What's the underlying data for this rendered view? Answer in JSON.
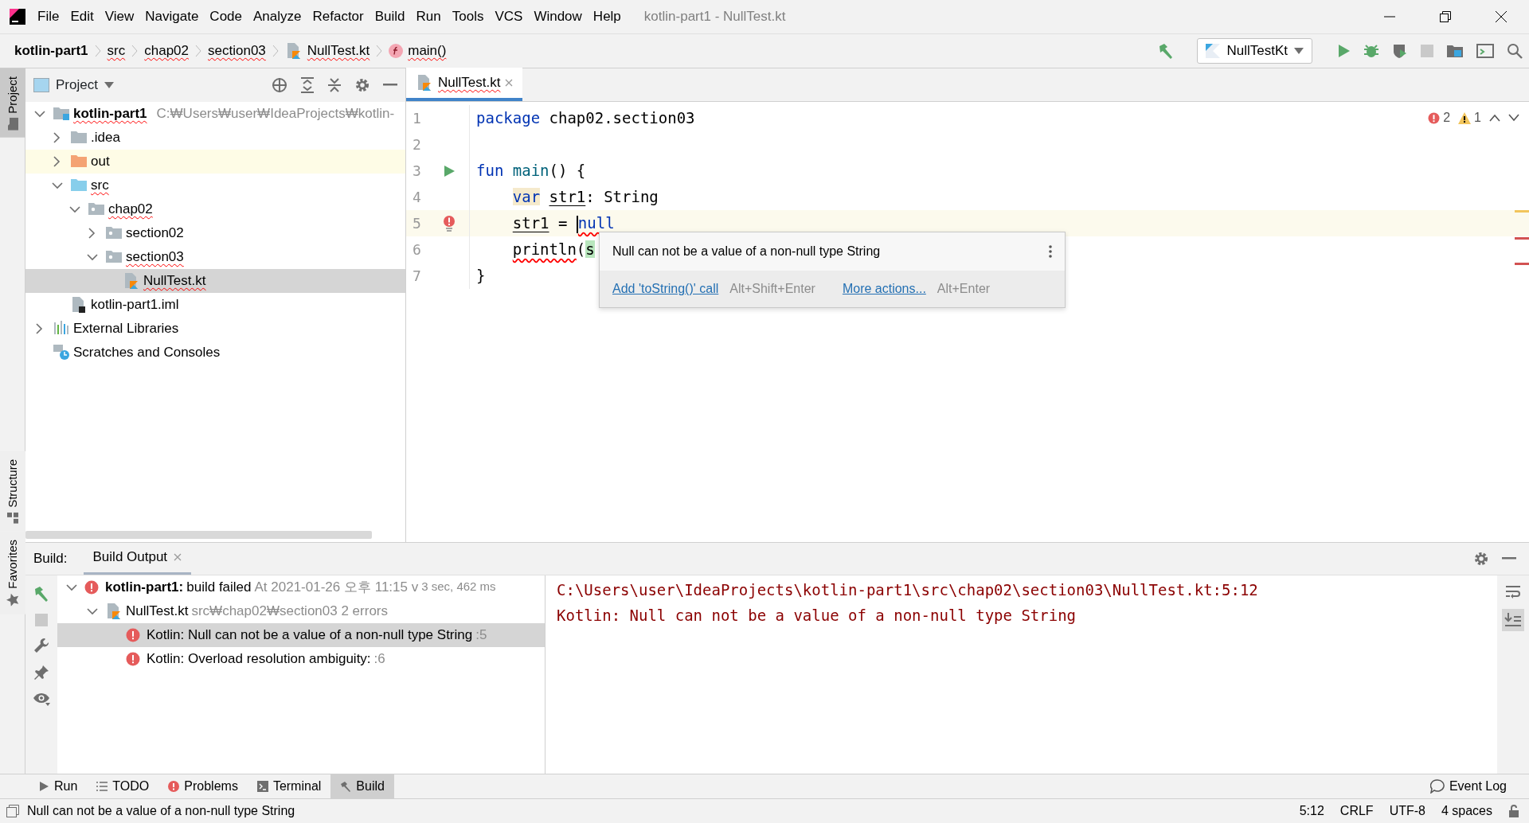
{
  "window": {
    "title": "kotlin-part1 - NullTest.kt"
  },
  "menu": [
    "File",
    "Edit",
    "View",
    "Navigate",
    "Code",
    "Analyze",
    "Refactor",
    "Build",
    "Run",
    "Tools",
    "VCS",
    "Window",
    "Help"
  ],
  "breadcrumbs": [
    {
      "label": "kotlin-part1",
      "kind": "project",
      "error": false
    },
    {
      "label": "src",
      "kind": "folder",
      "error": true
    },
    {
      "label": "chap02",
      "kind": "folder",
      "error": true
    },
    {
      "label": "section03",
      "kind": "folder",
      "error": true
    },
    {
      "label": "NullTest.kt",
      "kind": "file",
      "error": true
    },
    {
      "label": "main()",
      "kind": "function",
      "error": true
    }
  ],
  "run_config": {
    "label": "NullTestKt"
  },
  "left_stripe": [
    {
      "label": "Project",
      "selected": true,
      "kind": "top"
    },
    {
      "label": "Structure",
      "selected": false,
      "kind": "bottom"
    },
    {
      "label": "Favorites",
      "selected": false,
      "kind": "bottom"
    }
  ],
  "project_panel": {
    "title": "Project",
    "tree": [
      {
        "label": "kotlin-part1",
        "kind": "module",
        "path": "C:₩Users₩user₩IdeaProjects₩kotlin-",
        "error": true,
        "expanded": true,
        "selected": false,
        "highlighted": false,
        "children": [
          {
            "label": ".idea",
            "kind": "folder",
            "error": false,
            "expanded": false,
            "selected": false,
            "highlighted": false
          },
          {
            "label": "out",
            "kind": "excluded",
            "error": false,
            "expanded": false,
            "selected": false,
            "highlighted": true
          },
          {
            "label": "src",
            "kind": "source",
            "error": true,
            "expanded": true,
            "selected": false,
            "highlighted": false,
            "children": [
              {
                "label": "chap02",
                "kind": "package",
                "error": true,
                "expanded": true,
                "selected": false,
                "highlighted": false,
                "children": [
                  {
                    "label": "section02",
                    "kind": "package",
                    "error": false,
                    "expanded": false,
                    "selected": false,
                    "highlighted": false
                  },
                  {
                    "label": "section03",
                    "kind": "package",
                    "error": true,
                    "expanded": true,
                    "selected": false,
                    "highlighted": false,
                    "children": [
                      {
                        "label": "NullTest.kt",
                        "kind": "kotlin",
                        "error": true,
                        "selected": true,
                        "highlighted": false
                      }
                    ]
                  }
                ]
              }
            ]
          },
          {
            "label": "kotlin-part1.iml",
            "kind": "iml",
            "error": false,
            "selected": false,
            "highlighted": false
          }
        ]
      },
      {
        "label": "External Libraries",
        "kind": "library",
        "error": false,
        "expanded": false,
        "selected": false,
        "highlighted": false
      },
      {
        "label": "Scratches and Consoles",
        "kind": "scratch",
        "error": false,
        "selected": false,
        "highlighted": false
      }
    ]
  },
  "editor": {
    "tabs": [
      {
        "label": "NullTest.kt",
        "selected": true,
        "error": true
      }
    ],
    "error_count": "2",
    "warning_count": "1",
    "lines": [
      {
        "number": "1",
        "current": false,
        "indented": false,
        "tokens": [
          {
            "text": "package",
            "kind": "keyword"
          },
          {
            "text": "chap02.section03",
            "kind": "text",
            "space_before": true
          }
        ]
      },
      {
        "number": "2",
        "current": false
      },
      {
        "number": "3",
        "kind": "run",
        "current": false,
        "indented": false,
        "tokens": [
          {
            "text": "fun",
            "kind": "keyword"
          },
          {
            "text": "main",
            "kind": "function",
            "space_before": true
          },
          {
            "text": "() {",
            "kind": "text"
          }
        ]
      },
      {
        "number": "4",
        "current": false,
        "indented": true,
        "tokens": [
          {
            "text": "var",
            "kind": "var-keyword"
          },
          {
            "text": "str1",
            "kind": "variable",
            "space_before": true
          },
          {
            "text": ": String",
            "kind": "text"
          }
        ]
      },
      {
        "number": "5",
        "kind": "error",
        "current": true,
        "indented": true,
        "tokens": [
          {
            "text": "str1",
            "kind": "variable"
          },
          {
            "text": "=",
            "kind": "text",
            "space_before": true
          },
          {
            "text": "null",
            "kind": "error-keyword",
            "space_before": true,
            "caret": true
          }
        ]
      },
      {
        "number": "6",
        "current": false,
        "indented": true,
        "tokens": [
          {
            "text": "println",
            "kind": "error"
          },
          {
            "text": "(",
            "kind": "text"
          },
          {
            "text": "s",
            "kind": "match"
          }
        ]
      },
      {
        "number": "7",
        "current": false,
        "indented": false,
        "tokens": [
          {
            "text": "}",
            "kind": "text"
          }
        ]
      }
    ],
    "tooltip": {
      "message": "Null can not be a value of a non-null type String",
      "actions": [
        {
          "label": "Add 'toString()' call",
          "shortcut": "Alt+Shift+Enter"
        },
        {
          "label": "More actions...",
          "shortcut": "Alt+Enter"
        }
      ]
    }
  },
  "build": {
    "label": "Build:",
    "tabs": [
      {
        "label": "Build Output",
        "selected": true
      }
    ],
    "tree": [
      {
        "kind": "root",
        "name": "kotlin-part1:",
        "status": "build failed",
        "detail": "At 2021-01-26 오후 11:15 v",
        "time": "3 sec, 462 ms",
        "expanded": true,
        "selected": false,
        "children": [
          {
            "kind": "file",
            "name": "NullTest.kt",
            "detail": "src₩chap02₩section03 2 errors",
            "expanded": true,
            "selected": false,
            "children": [
              {
                "kind": "error",
                "name": "Kotlin: Null can not be a value of a non-null type String",
                "detail": ":5",
                "selected": true
              },
              {
                "kind": "error",
                "name": "Kotlin: Overload resolution ambiguity:",
                "detail": ":6",
                "selected": false
              }
            ]
          }
        ]
      }
    ],
    "output": {
      "link": "C:\\Users\\user\\IdeaProjects\\kotlin-part1\\src\\chap02\\section03\\NullTest.kt",
      "position": ":5:12",
      "message": "Kotlin: Null can not be a value of a non-null type String"
    }
  },
  "bottom_tabs": [
    {
      "label": "Run",
      "kind": "run",
      "selected": false
    },
    {
      "label": "TODO",
      "kind": "todo",
      "selected": false
    },
    {
      "label": "Problems",
      "kind": "problems",
      "selected": false
    },
    {
      "label": "Terminal",
      "kind": "terminal",
      "selected": false
    },
    {
      "label": "Build",
      "kind": "build",
      "selected": true
    }
  ],
  "event_log": "Event Log",
  "status_bar": {
    "message": "Null can not be a value of a non-null type String",
    "items": [
      "5:12",
      "CRLF",
      "UTF-8",
      "4 spaces"
    ]
  }
}
